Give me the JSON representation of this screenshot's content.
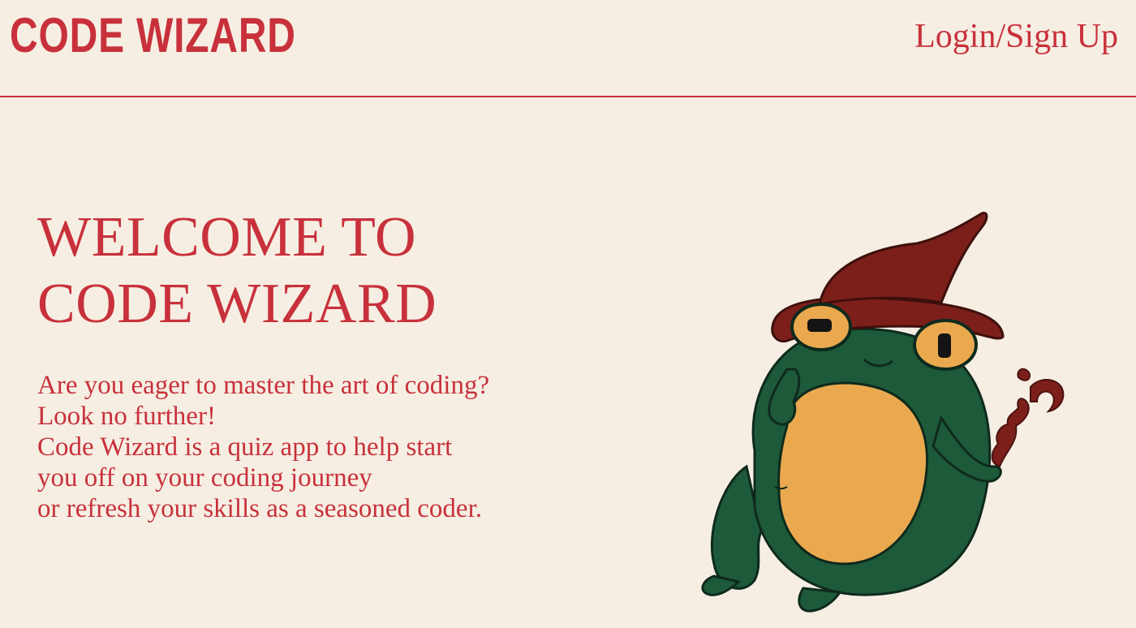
{
  "header": {
    "logo": "CODE WIZARD",
    "login_link": "Login/Sign Up"
  },
  "hero": {
    "title_lines": [
      "WELCOME TO",
      "CODE WIZARD"
    ],
    "text_lines": [
      "Are you eager to master the art of coding?",
      "Look no further!",
      "Code Wizard is a quiz app to help start",
      "you off on your coding journey",
      "or refresh your skills as a seasoned coder."
    ],
    "mascot": "frog-wizard-illustration"
  },
  "colors": {
    "background": "#f6eee3",
    "accent": "#c8313b",
    "frog_green": "#1d5a3a",
    "belly": "#eaa94f",
    "hat": "#7c1f1a"
  }
}
